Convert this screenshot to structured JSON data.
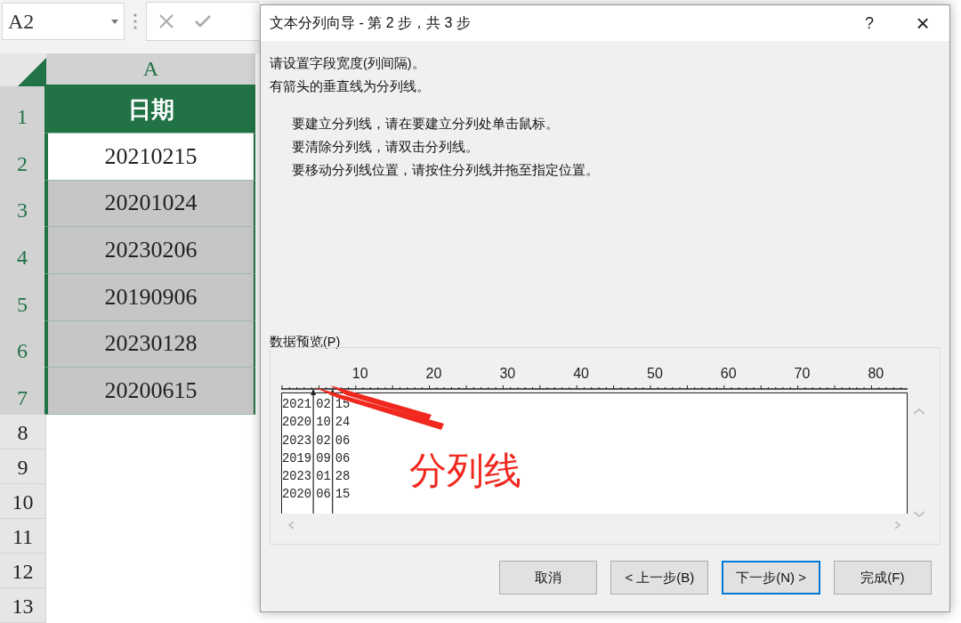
{
  "sheet": {
    "name_box": "A2",
    "column_header": "A",
    "header_cell": "日期",
    "rows": [
      {
        "number": "1",
        "selected": true,
        "kind": "header"
      },
      {
        "number": "2",
        "selected": true,
        "kind": "active",
        "value": "20210215"
      },
      {
        "number": "3",
        "selected": true,
        "kind": "data",
        "value": "20201024"
      },
      {
        "number": "4",
        "selected": true,
        "kind": "data",
        "value": "20230206"
      },
      {
        "number": "5",
        "selected": true,
        "kind": "data",
        "value": "20190906"
      },
      {
        "number": "6",
        "selected": true,
        "kind": "data",
        "value": "20230128"
      },
      {
        "number": "7",
        "selected": true,
        "kind": "data",
        "value": "20200615"
      },
      {
        "number": "8",
        "selected": false,
        "kind": "empty"
      },
      {
        "number": "9",
        "selected": false,
        "kind": "empty"
      },
      {
        "number": "10",
        "selected": false,
        "kind": "empty"
      },
      {
        "number": "11",
        "selected": false,
        "kind": "empty"
      },
      {
        "number": "12",
        "selected": false,
        "kind": "empty"
      },
      {
        "number": "13",
        "selected": false,
        "kind": "empty"
      }
    ]
  },
  "dialog": {
    "title": "文本分列向导 - 第 2 步，共 3 步",
    "help": "?",
    "close": "×",
    "intro": [
      "请设置字段宽度(列间隔)。",
      "有箭头的垂直线为分列线。"
    ],
    "instructions": [
      "要建立分列线，请在要建立分列处单击鼠标。",
      "要清除分列线，请双击分列线。",
      "要移动分列线位置，请按住分列线并拖至指定位置。"
    ],
    "preview": {
      "label": "数据预览(P)",
      "ruler_labels": [
        "10",
        "20",
        "30",
        "40",
        "50",
        "60",
        "70",
        "80"
      ],
      "rows": [
        {
          "fields": [
            "2021",
            "02",
            "15"
          ]
        },
        {
          "fields": [
            "2020",
            "10",
            "24"
          ]
        },
        {
          "fields": [
            "2023",
            "02",
            "06"
          ]
        },
        {
          "fields": [
            "2019",
            "09",
            "06"
          ]
        },
        {
          "fields": [
            "2023",
            "01",
            "28"
          ]
        },
        {
          "fields": [
            "2020",
            "06",
            "15"
          ]
        }
      ]
    },
    "buttons": [
      {
        "label": "取消",
        "selected": false
      },
      {
        "label": "< 上一步(B)",
        "selected": false
      },
      {
        "label": "下一步(N) >",
        "selected": true
      },
      {
        "label": "完成(F)",
        "selected": false
      }
    ]
  },
  "annotation": {
    "label": "分列线"
  }
}
